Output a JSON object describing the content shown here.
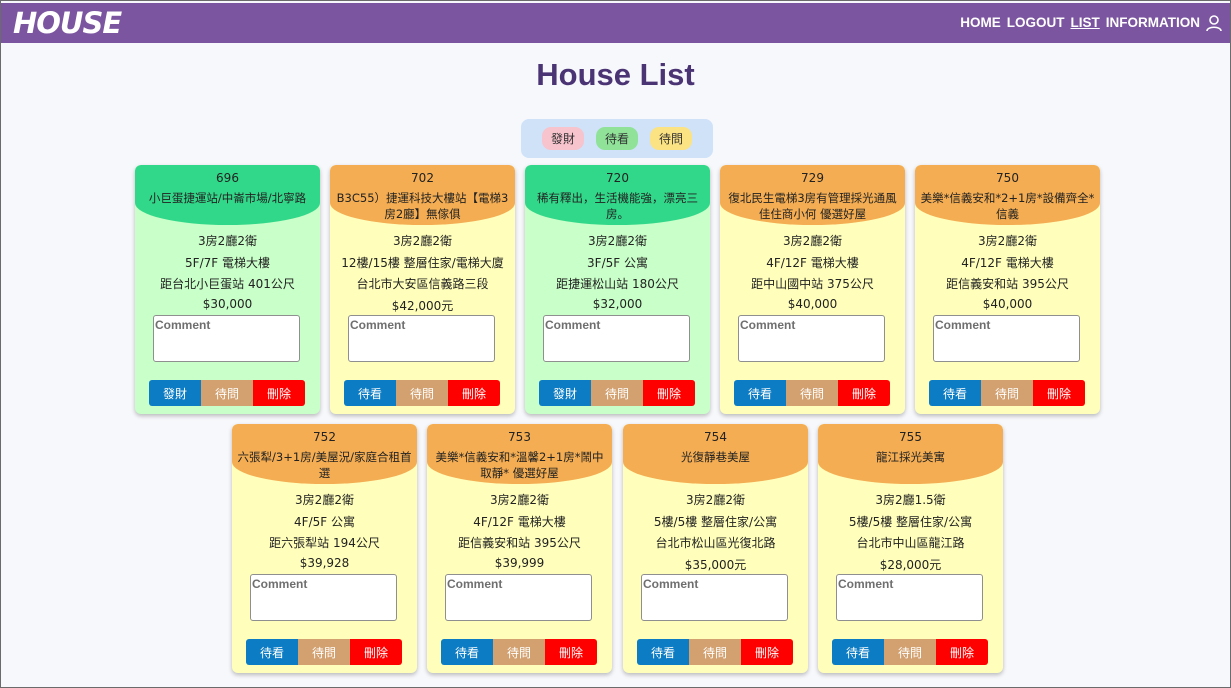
{
  "nav": {
    "logo": "HOUSE",
    "links": [
      "HOME",
      "LOGOUT",
      "LIST",
      "INFORMATION"
    ],
    "active": "LIST",
    "user_icon": "user-icon"
  },
  "page": {
    "title": "House List"
  },
  "legend": [
    "發財",
    "待看",
    "待問"
  ],
  "colors": {
    "navbar": "#7b559f",
    "title": "#4b3474",
    "header_orange": "#f4ad52",
    "header_teal": "#32d889",
    "body_yellow": "#ffffbb",
    "body_green": "#c9ffc8",
    "btn_blue": "#0c7cc4",
    "btn_tan": "#d3a06f",
    "btn_red": "#ff0000"
  },
  "comment_placeholder": "Comment",
  "cards": [
    {
      "id": "696",
      "title": "小巨蛋捷運站/中崙市場/北寧路",
      "layout": "3房2廳2衛",
      "floor": "5F/7F 電梯大樓",
      "location": "距台北小巨蛋站 401公尺",
      "price": "$30,000",
      "buttons": [
        "發財",
        "待問",
        "刪除"
      ]
    },
    {
      "id": "702",
      "title": "B3C55）捷運科技大樓站【電梯3房2廳】無傢俱",
      "layout": "3房2廳2衛",
      "floor": "12樓/15樓 整層住家/電梯大廈",
      "location": "台北市大安區信義路三段",
      "price": "$42,000元",
      "buttons": [
        "待看",
        "待問",
        "刪除"
      ]
    },
    {
      "id": "720",
      "title": "稀有釋出，生活機能強，漂亮三房。",
      "layout": "3房2廳2衛",
      "floor": "3F/5F 公寓",
      "location": "距捷運松山站 180公尺",
      "price": "$32,000",
      "buttons": [
        "發財",
        "待問",
        "刪除"
      ]
    },
    {
      "id": "729",
      "title": "復北民生電梯3房有管理採光通風佳住商小何 優選好屋",
      "layout": "3房2廳2衛",
      "floor": "4F/12F 電梯大樓",
      "location": "距中山國中站 375公尺",
      "price": "$40,000",
      "buttons": [
        "待看",
        "待問",
        "刪除"
      ]
    },
    {
      "id": "750",
      "title": "美樂*信義安和*2+1房*設備齊全*信義",
      "layout": "3房2廳2衛",
      "floor": "4F/12F 電梯大樓",
      "location": "距信義安和站 395公尺",
      "price": "$40,000",
      "buttons": [
        "待看",
        "待問",
        "刪除"
      ]
    },
    {
      "id": "752",
      "title": "六張犁/3+1房/美屋況/家庭合租首選",
      "layout": "3房2廳2衛",
      "floor": "4F/5F 公寓",
      "location": "距六張犁站 194公尺",
      "price": "$39,928",
      "buttons": [
        "待看",
        "待問",
        "刪除"
      ]
    },
    {
      "id": "753",
      "title": "美樂*信義安和*溫馨2+1房*鬧中取靜* 優選好屋",
      "layout": "3房2廳2衛",
      "floor": "4F/12F 電梯大樓",
      "location": "距信義安和站 395公尺",
      "price": "$39,999",
      "buttons": [
        "待看",
        "待問",
        "刪除"
      ]
    },
    {
      "id": "754",
      "title": "光復靜巷美屋",
      "layout": "3房2廳2衛",
      "floor": "5樓/5樓 整層住家/公寓",
      "location": "台北市松山區光復北路",
      "price": "$35,000元",
      "buttons": [
        "待看",
        "待問",
        "刪除"
      ]
    },
    {
      "id": "755",
      "title": "龍江採光美寓",
      "layout": "3房2廳1.5衛",
      "floor": "5樓/5樓 整層住家/公寓",
      "location": "台北市中山區龍江路",
      "price": "$28,000元",
      "buttons": [
        "待看",
        "待問",
        "刪除"
      ]
    }
  ]
}
